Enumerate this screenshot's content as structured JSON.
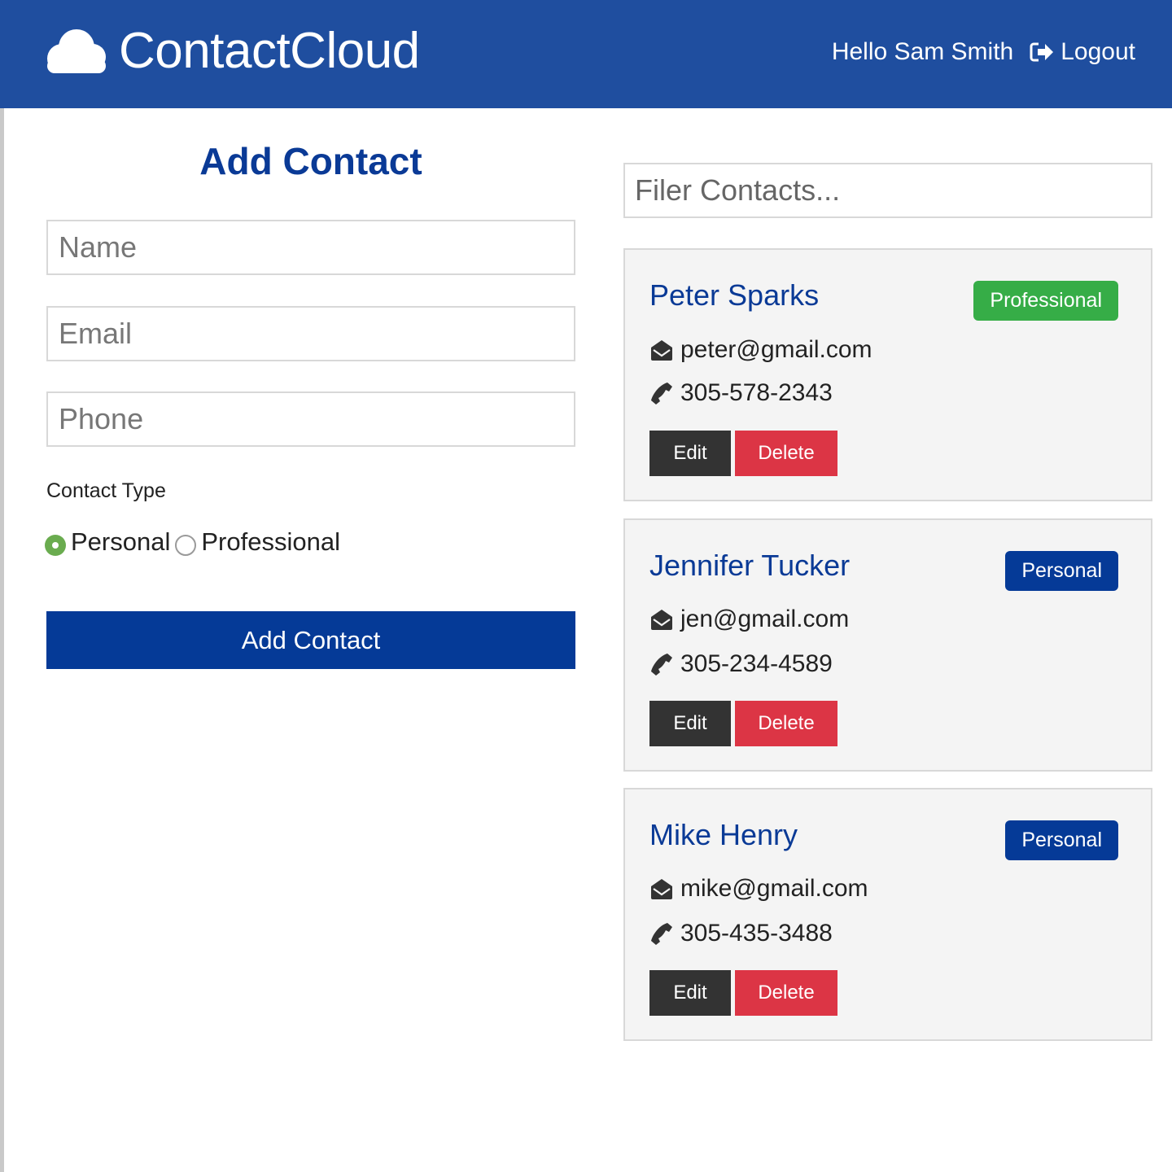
{
  "navbar": {
    "brand": "ContactCloud",
    "brand_icon": "cloud-icon",
    "greeting": "Hello Sam Smith",
    "logout_label": "Logout",
    "logout_icon": "sign-out-icon",
    "background_color": "#1f4e9f"
  },
  "form": {
    "title": "Add Contact",
    "name_placeholder": "Name",
    "name_value": "",
    "email_placeholder": "Email",
    "email_value": "",
    "phone_placeholder": "Phone",
    "phone_value": "",
    "contact_type_label": "Contact Type",
    "contact_type_options": [
      "Personal",
      "Professional"
    ],
    "contact_type_selected": "Personal",
    "submit_label": "Add Contact"
  },
  "filter": {
    "placeholder": "Filer Contacts...",
    "value": ""
  },
  "contacts": [
    {
      "name": "Peter Sparks",
      "email": "peter@gmail.com",
      "phone": "305-578-2343",
      "type": "Professional",
      "type_color": "#36ad47",
      "edit_label": "Edit",
      "delete_label": "Delete"
    },
    {
      "name": "Jennifer Tucker",
      "email": "jen@gmail.com",
      "phone": "305-234-4589",
      "type": "Personal",
      "type_color": "#053a97",
      "edit_label": "Edit",
      "delete_label": "Delete"
    },
    {
      "name": "Mike Henry",
      "email": "mike@gmail.com",
      "phone": "305-435-3488",
      "type": "Personal",
      "type_color": "#053a97",
      "edit_label": "Edit",
      "delete_label": "Delete"
    }
  ],
  "icons": {
    "email": "envelope-open-icon",
    "phone": "phone-icon"
  },
  "colors": {
    "primary": "#053a97",
    "heading": "#0a3a96",
    "success": "#36ad47",
    "danger": "#dc3545",
    "dark": "#333333",
    "card_bg": "#f4f4f4"
  }
}
